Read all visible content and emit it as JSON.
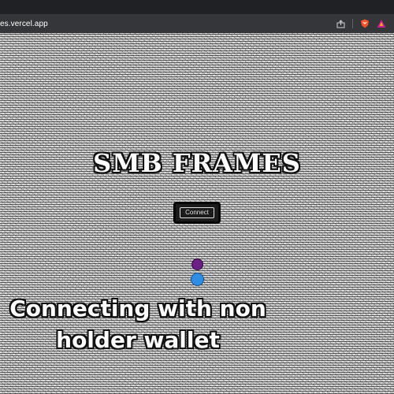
{
  "browser": {
    "url_prefix": "",
    "url_host": "es.vercel.app",
    "icons": [
      "share-icon",
      "brave-shield-icon",
      "rewards-triangle-icon"
    ]
  },
  "page": {
    "title": "SMB FRAMES",
    "connect_button_label": "Connect",
    "description": "",
    "status_message": "Connecting with non holder wallet"
  },
  "colors": {
    "chrome_dark": "#202124",
    "address_bar": "#35363a",
    "dot_purple": "#6b1f86",
    "dot_blue": "#2f8de4",
    "brave_orange": "#fb542b"
  }
}
